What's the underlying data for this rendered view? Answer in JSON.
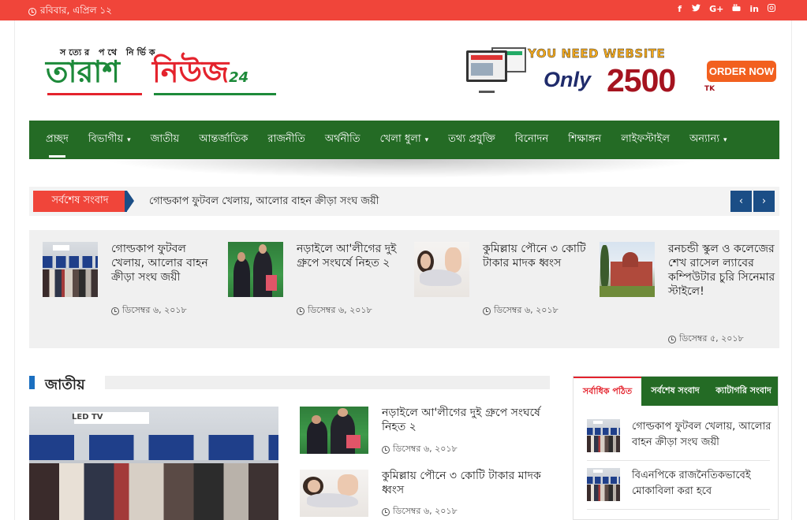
{
  "topbar": {
    "date": "রবিবার, এপ্রিল ১২",
    "social": [
      "f",
      "t",
      "G+",
      "yt",
      "in",
      "ig"
    ]
  },
  "logo": {
    "tagline": "সত্যের পথে নির্ভিক",
    "name_part1": "তারাশ",
    "name_part2": "নিউজ",
    "name_num": "24"
  },
  "ad": {
    "headline": "YOU NEED WEBSITE",
    "only": "Only",
    "price": "2500",
    "currency": "TK",
    "cta": "ORDER NOW"
  },
  "nav": {
    "items": [
      {
        "label": "প্রচ্ছদ",
        "active": true,
        "dropdown": false
      },
      {
        "label": "বিভাগীয়",
        "dropdown": true
      },
      {
        "label": "জাতীয়",
        "dropdown": false
      },
      {
        "label": "আন্তর্জাতিক",
        "dropdown": false
      },
      {
        "label": "রাজনীতি",
        "dropdown": false
      },
      {
        "label": "অর্থনীতি",
        "dropdown": false
      },
      {
        "label": "খেলা ধুলা",
        "dropdown": true
      },
      {
        "label": "তথ্য প্রযুক্তি",
        "dropdown": false
      },
      {
        "label": "বিনোদন",
        "dropdown": false
      },
      {
        "label": "শিক্ষাঙ্গন",
        "dropdown": false
      },
      {
        "label": "লাইফস্টাইল",
        "dropdown": false
      },
      {
        "label": "অন্যান্য",
        "dropdown": true
      }
    ]
  },
  "ticker": {
    "label": "সর্বশেষ সংবাদ",
    "text": "গোল্ডকাপ ফুটবল খেলায়, আলোর বাহন ক্রীড়া সংঘ জয়ী",
    "prev_icon": "‹",
    "next_icon": "›"
  },
  "featured": [
    {
      "title": "গোল্ডকাপ ফুটবল খেলায়, আলোর বাহন ক্রীড়া সংঘ জয়ী",
      "date": "ডিসেম্বর ৬, ২০১৮",
      "image": "tv-fair"
    },
    {
      "title": "নড়াইলে আ'লীগের দুই গ্রুপে সংঘর্ষে নিহত ২",
      "date": "ডিসেম্বর ৬, ২০১৮",
      "image": "politicians"
    },
    {
      "title": "কুমিল্লায় পৌনে ৩ কোটি টাকার মাদক ধ্বংস",
      "date": "ডিসেম্বর ৬, ২০১৮",
      "image": "lady"
    },
    {
      "title": "রনচন্ডী স্কুল ও কলেজের শেখ রাসেল ল্যাবের কম্পিউটার চুরি সিনেমার স্টাইলে!",
      "date": "ডিসেম্বর ৫, ২০১৮",
      "image": "building"
    }
  ],
  "section": {
    "title": "জাতীয়",
    "big_image_label": "LED TV",
    "list": [
      {
        "title": "নড়াইলে আ'লীগের দুই গ্রুপে সংঘর্ষে নিহত ২",
        "date": "ডিসেম্বর ৬, ২০১৮",
        "image": "politicians"
      },
      {
        "title": "কুমিল্লায় পৌনে ৩ কোটি টাকার মাদক ধ্বংস",
        "date": "ডিসেম্বর ৬, ২০১৮",
        "image": "lady"
      }
    ]
  },
  "sidebar": {
    "tabs": [
      "সর্বাধিক পঠিত",
      "সর্বশেষ সংবাদ",
      "ক্যাটাগরি সংবাদ"
    ],
    "items": [
      {
        "title": "গোল্ডকাপ ফুটবল খেলায়, আলোর বাহন ক্রীড়া সংঘ জয়ী",
        "image": "tv-fair"
      },
      {
        "title": "বিএনপিকে রাজনৈতিকভাবেই মোকাবিলা করা হবে",
        "image": "tv-fair"
      }
    ]
  },
  "colors": {
    "topbar": "#f0453a",
    "nav": "#246b25",
    "accent_blue": "#1b4e86",
    "logo_green": "#1d8a3a",
    "logo_red": "#e4232d"
  }
}
